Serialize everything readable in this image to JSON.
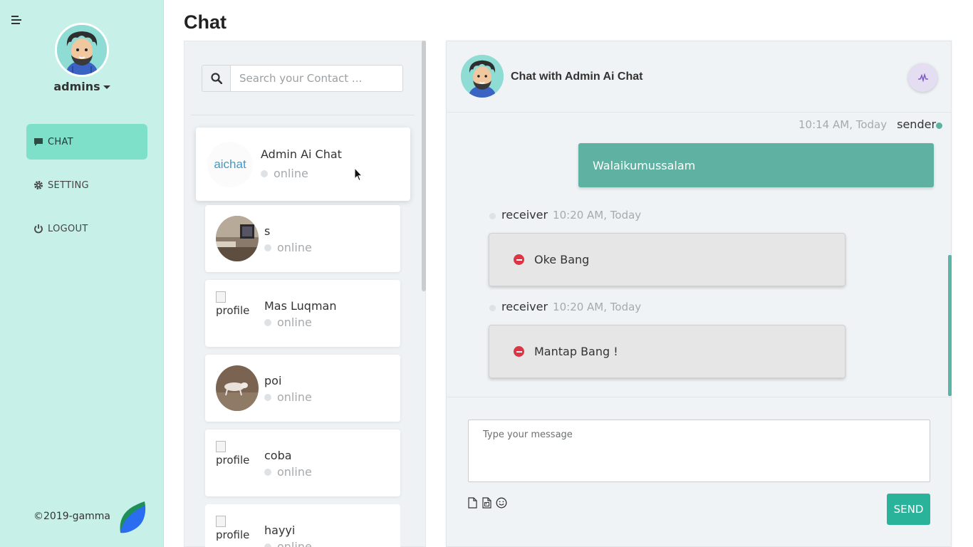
{
  "app": {
    "page_title": "Chat"
  },
  "sidebar": {
    "username": "admins",
    "nav": [
      {
        "label": "CHAT",
        "icon": "comment-icon",
        "active": true
      },
      {
        "label": "SETTING",
        "icon": "gear-icon",
        "active": false
      },
      {
        "label": "LOGOUT",
        "icon": "power-icon",
        "active": false
      }
    ],
    "copyright": "©2019-gamma"
  },
  "contacts": {
    "search_placeholder": "Search your Contact ...",
    "list": [
      {
        "name": "Admin Ai Chat",
        "status": "online",
        "avatar": "aichat-logo",
        "logo_text": "aichat"
      },
      {
        "name": "s",
        "status": "online",
        "avatar": "photo-room"
      },
      {
        "name": "Mas Luqman",
        "status": "online",
        "avatar": "broken-image",
        "alt": "profile"
      },
      {
        "name": "poi",
        "status": "online",
        "avatar": "photo-floor"
      },
      {
        "name": "coba",
        "status": "online",
        "avatar": "broken-image",
        "alt": "profile"
      },
      {
        "name": "hayyi",
        "status": "online",
        "avatar": "broken-image",
        "alt": "profile"
      }
    ]
  },
  "chat": {
    "title": "Chat with Admin Ai Chat",
    "messages": [
      {
        "direction": "sent",
        "role": "sender",
        "time": "10:14 AM, Today",
        "text": "Walaikumussalam"
      },
      {
        "direction": "received",
        "role": "receiver",
        "time": "10:20 AM, Today",
        "text": "Oke Bang"
      },
      {
        "direction": "received",
        "role": "receiver",
        "time": "10:20 AM, Today",
        "text": "Mantap Bang !"
      }
    ],
    "input_placeholder": "Type your message",
    "send_label": "SEND"
  },
  "colors": {
    "sidebar_bg": "#c7f1e8",
    "nav_active": "#7ee0c9",
    "sent_bubble": "#5fb1a2",
    "received_bubble": "#e6e6e6",
    "send_button": "#28b39a",
    "online_dot_sender": "#5fb1a2",
    "delete_icon": "#dc3545"
  }
}
